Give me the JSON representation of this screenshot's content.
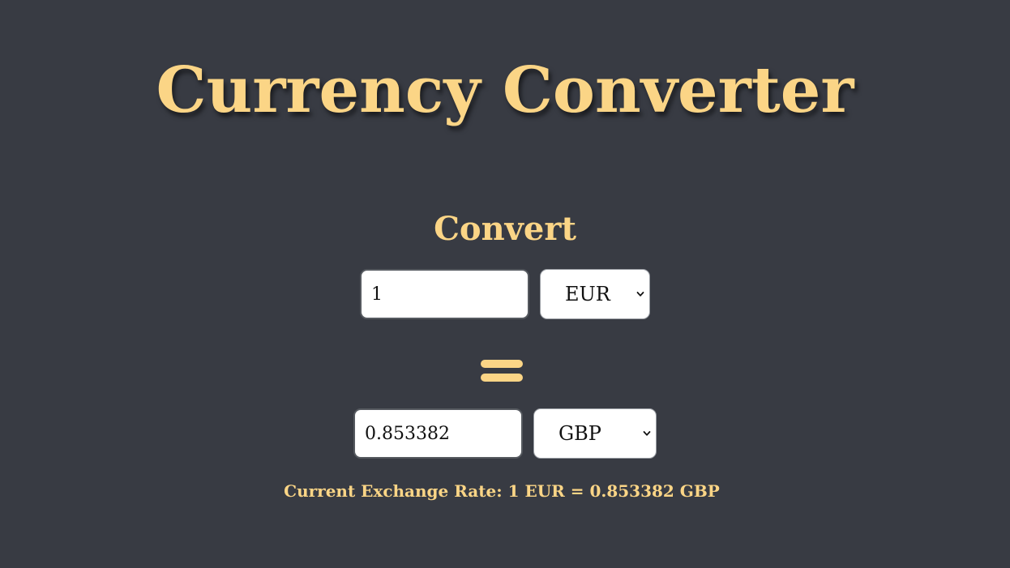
{
  "app": {
    "title": "Currency Converter"
  },
  "converter": {
    "heading": "Convert",
    "from_amount": "1",
    "from_currency": "EUR",
    "to_amount": "0.853382",
    "to_currency": "GBP",
    "rate_text": "Current Exchange Rate: 1 EUR = 0.853382 GBP"
  },
  "icons": {
    "equals": "equals-icon",
    "dropdown": "chevron-down-icon"
  },
  "colors": {
    "background": "#383b43",
    "accent": "#fbd586",
    "field_bg": "#ffffff"
  }
}
